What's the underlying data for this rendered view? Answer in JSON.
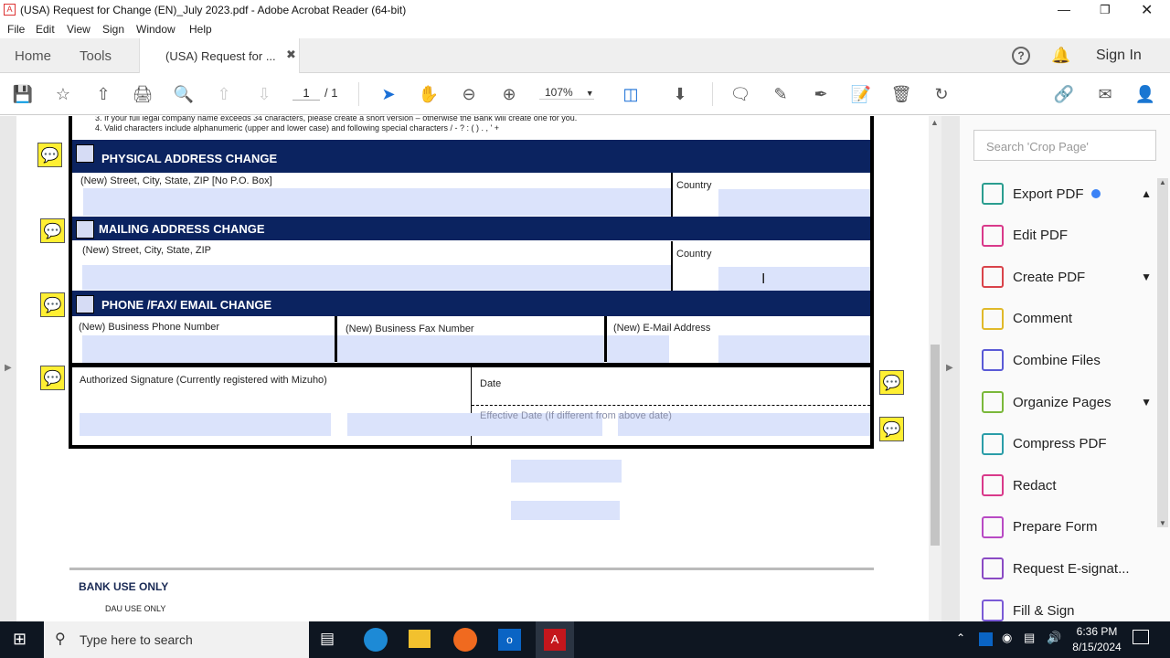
{
  "window": {
    "title": "(USA) Request for Change (EN)_July 2023.pdf - Adobe Acrobat Reader (64-bit)"
  },
  "menu": [
    "File",
    "Edit",
    "View",
    "Sign",
    "Window",
    "Help"
  ],
  "tabs": {
    "home": "Home",
    "tools": "Tools",
    "doc_tab": "(USA) Request for ...",
    "sign_in": "Sign In"
  },
  "toolbar": {
    "page_current": "1",
    "page_total": "/ 1",
    "zoom": "107%"
  },
  "doc": {
    "note3": "3.   If your full legal company name exceeds 34 characters, please create a short version – otherwise the Bank will create one for you.",
    "note4": "4.   Valid characters include alphanumeric (upper and lower case) and following special characters / - ? : ( ) . , ' +",
    "physical_header": "PHYSICAL ADDRESS CHANGE",
    "physical_street": "(New) Street, City, State, ZIP [No P.O. Box]",
    "country": "Country",
    "mailing_header": "MAILING ADDRESS CHANGE",
    "mailing_street": "(New) Street, City, State, ZIP",
    "phone_header": "PHONE /FAX/ EMAIL CHANGE",
    "phone": "(New) Business Phone Number",
    "fax": "(New) Business Fax Number",
    "email": "(New) E-Mail Address",
    "signature": "Authorized Signature (Currently registered with Mizuho)",
    "date": "Date",
    "effective_date": "Effective Date (If different from above date)",
    "bank_use": "BANK USE ONLY",
    "dau_use": "DAU USE ONLY"
  },
  "right_panel": {
    "search_placeholder": "Search 'Crop Page'",
    "tools": [
      {
        "label": "Export PDF",
        "color": "#2a9d8f",
        "chevron": "^"
      },
      {
        "label": "Edit PDF",
        "color": "#d9398a",
        "chevron": ""
      },
      {
        "label": "Create PDF",
        "color": "#d9434a",
        "chevron": "v"
      },
      {
        "label": "Comment",
        "color": "#e0b92a",
        "chevron": ""
      },
      {
        "label": "Combine Files",
        "color": "#5a5ad6",
        "chevron": ""
      },
      {
        "label": "Organize Pages",
        "color": "#7ab83a",
        "chevron": "v"
      },
      {
        "label": "Compress PDF",
        "color": "#2a9da8",
        "chevron": ""
      },
      {
        "label": "Redact",
        "color": "#d9398a",
        "chevron": ""
      },
      {
        "label": "Prepare Form",
        "color": "#b84ac4",
        "chevron": ""
      },
      {
        "label": "Request E-signat...",
        "color": "#8a4ac4",
        "chevron": ""
      },
      {
        "label": "Fill & Sign",
        "color": "#7a5ad6",
        "chevron": ""
      }
    ]
  },
  "taskbar": {
    "search_placeholder": "Type here to search",
    "time": "6:36 PM",
    "date": "8/15/2024"
  }
}
